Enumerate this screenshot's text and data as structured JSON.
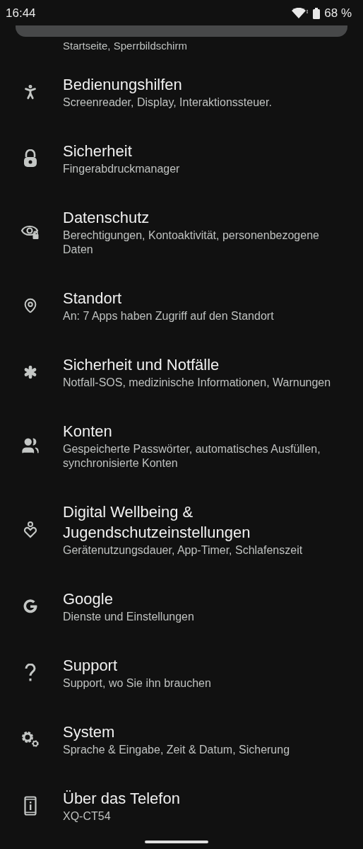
{
  "status_bar": {
    "time": "16:44",
    "battery": "68 %"
  },
  "partial_item": {
    "subtitle": "Startseite, Sperrbildschirm"
  },
  "items": [
    {
      "kind": "accessibility",
      "title": "Bedienungshilfen",
      "subtitle": "Screenreader, Display, Interaktionssteuer."
    },
    {
      "kind": "lock",
      "title": "Sicherheit",
      "subtitle": "Fingerabdruckmanager"
    },
    {
      "kind": "privacy",
      "title": "Datenschutz",
      "subtitle": "Berechtigungen, Kontoaktivität, personenbezogene Daten"
    },
    {
      "kind": "location",
      "title": "Standort",
      "subtitle": "An: 7 Apps haben Zugriff auf den Standort"
    },
    {
      "kind": "emergency",
      "title": "Sicherheit und Notfälle",
      "subtitle": "Notfall-SOS, medizinische Informationen, Warnungen"
    },
    {
      "kind": "accounts",
      "title": "Konten",
      "subtitle": "Gespeicherte Passwörter, automatisches Ausfüllen, synchronisierte Konten"
    },
    {
      "kind": "wellbeing",
      "title": "Digital Wellbeing & Jugendschutzeinstellungen",
      "subtitle": "Gerätenutzungsdauer, App-Timer, Schlafenszeit"
    },
    {
      "kind": "google",
      "title": "Google",
      "subtitle": "Dienste und Einstellungen"
    },
    {
      "kind": "help",
      "title": "Support",
      "subtitle": "Support, wo Sie ihn brauchen"
    },
    {
      "kind": "system",
      "title": "System",
      "subtitle": "Sprache & Eingabe, Zeit & Datum, Sicherung"
    },
    {
      "kind": "phone",
      "title": "Über das Telefon",
      "subtitle": "XQ-CT54"
    }
  ]
}
